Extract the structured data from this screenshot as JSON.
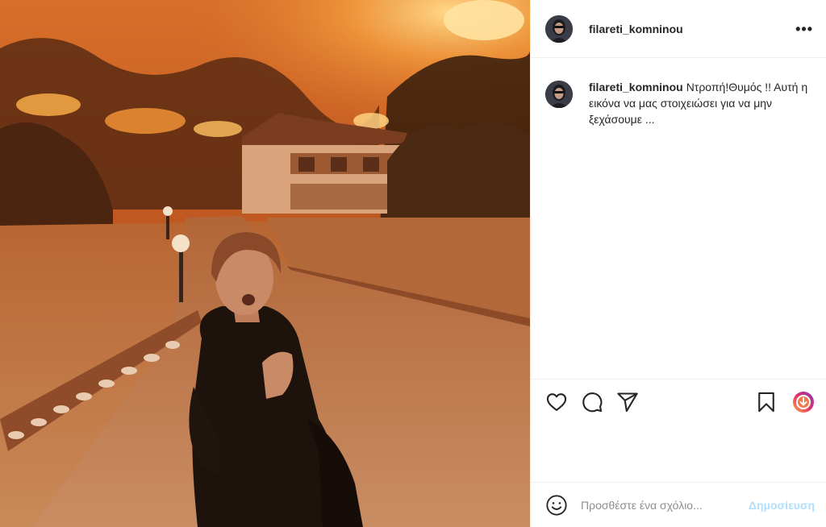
{
  "post": {
    "username": "filareti_komninou",
    "more_label": "•••",
    "photo_alt": "",
    "caption": {
      "username": "filareti_komninou",
      "text": "Ντροπή!Θυμός !! Αυτή η εικόνα να μας στοιχειώσει για να μην ξεχάσουμε ..."
    }
  },
  "actions": {
    "like_icon": "heart-icon",
    "comment_icon": "comment-icon",
    "share_icon": "paper-plane-icon",
    "save_icon": "bookmark-icon",
    "extension_icon": "download-extension-icon"
  },
  "comment_box": {
    "placeholder": "Προσθέστε ένα σχόλιο...",
    "post_label": "Δημοσίευση"
  },
  "colors": {
    "post_button_disabled": "#b2dffc",
    "border": "#efefef",
    "text": "#262626",
    "muted": "#8e8e8e"
  }
}
